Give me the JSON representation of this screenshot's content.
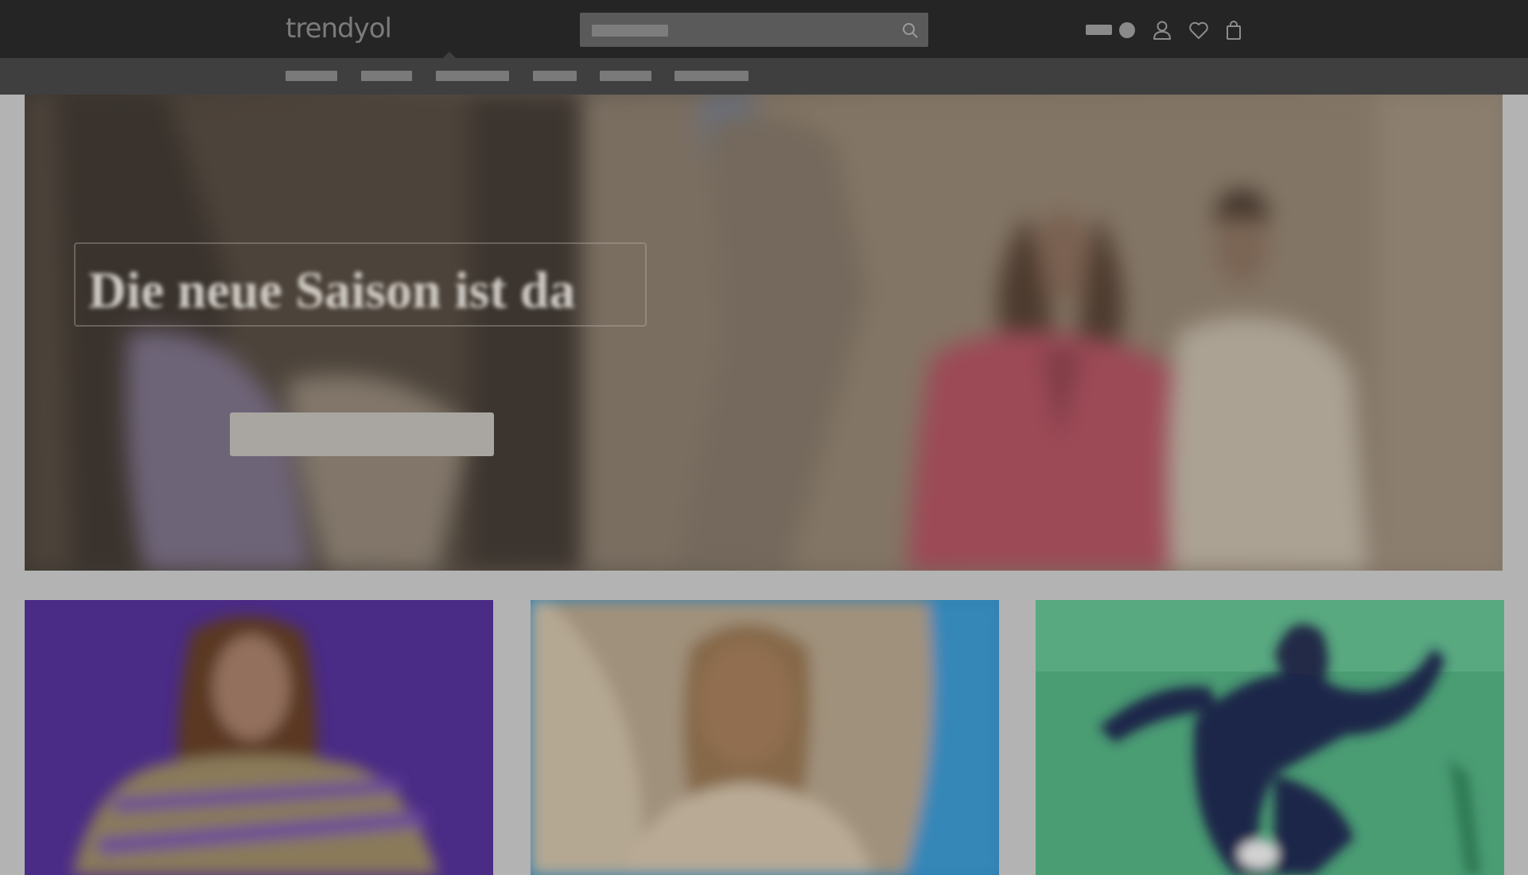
{
  "header": {
    "logo_text": "trendyol",
    "search": {
      "placeholder": ""
    },
    "language": {
      "label": ""
    },
    "icons": [
      "search-icon",
      "user-icon",
      "heart-icon",
      "shopping-bag-icon"
    ]
  },
  "category_nav": {
    "items": [
      {
        "label": ""
      },
      {
        "label": ""
      },
      {
        "label": ""
      },
      {
        "label": ""
      },
      {
        "label": ""
      },
      {
        "label": ""
      }
    ]
  },
  "hero": {
    "title": "Die neue Saison ist da",
    "subtitle": "",
    "cta_label": ""
  },
  "tiles": [
    {
      "name": "tile-1",
      "label": ""
    },
    {
      "name": "tile-2",
      "label": ""
    },
    {
      "name": "tile-3",
      "label": ""
    }
  ],
  "colors": {
    "header_bg": "#252525",
    "nav_bg": "#3f3f3f",
    "overlay_gray": "#b3b3b3",
    "tile_purple": "#4a2b86",
    "tile_blue": "#2e7fb0",
    "tile_green": "#3f9a6b"
  }
}
